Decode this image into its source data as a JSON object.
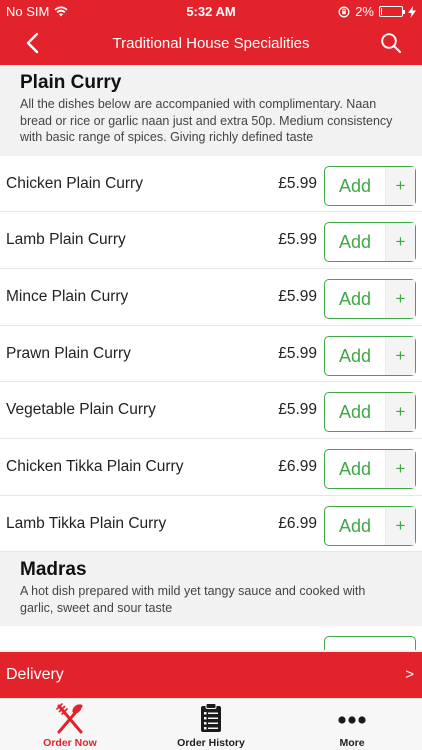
{
  "status_bar": {
    "carrier": "No SIM",
    "time": "5:32 AM",
    "battery": "2%",
    "battery_level": 0.02
  },
  "nav": {
    "title": "Traditional House Specialities"
  },
  "sections": [
    {
      "title": "Plain Curry",
      "description": " All the dishes below are accompanied with complimentary. Naan bread or rice or garlic naan just and extra 50p. Medium consistency with basic range of spices. Giving richly defined taste",
      "items": [
        {
          "name": "Chicken Plain Curry",
          "price": "£5.99",
          "add_label": "Add",
          "plus_label": "+"
        },
        {
          "name": "Lamb Plain Curry",
          "price": "£5.99",
          "add_label": "Add",
          "plus_label": "+"
        },
        {
          "name": "Mince Plain Curry",
          "price": "£5.99",
          "add_label": "Add",
          "plus_label": "+"
        },
        {
          "name": "Prawn Plain Curry",
          "price": "£5.99",
          "add_label": "Add",
          "plus_label": "+"
        },
        {
          "name": "Vegetable Plain Curry",
          "price": "£5.99",
          "add_label": "Add",
          "plus_label": "+"
        },
        {
          "name": "Chicken Tikka Plain Curry",
          "price": "£6.99",
          "add_label": "Add",
          "plus_label": "+"
        },
        {
          "name": "Lamb Tikka Plain Curry",
          "price": "£6.99",
          "add_label": "Add",
          "plus_label": "+"
        }
      ]
    },
    {
      "title": "Madras",
      "description": " A hot dish prepared with mild yet tangy sauce and cooked with garlic, sweet and sour taste"
    }
  ],
  "delivery": {
    "label": "Delivery",
    "arrow": ">"
  },
  "tabs": [
    {
      "label": "Order Now",
      "icon": "fork-knife-icon"
    },
    {
      "label": "Order History",
      "icon": "clipboard-icon"
    },
    {
      "label": "More",
      "icon": "more-dots-icon"
    }
  ],
  "colors": {
    "brand_red": "#e3232b",
    "add_green": "#3fa845"
  }
}
